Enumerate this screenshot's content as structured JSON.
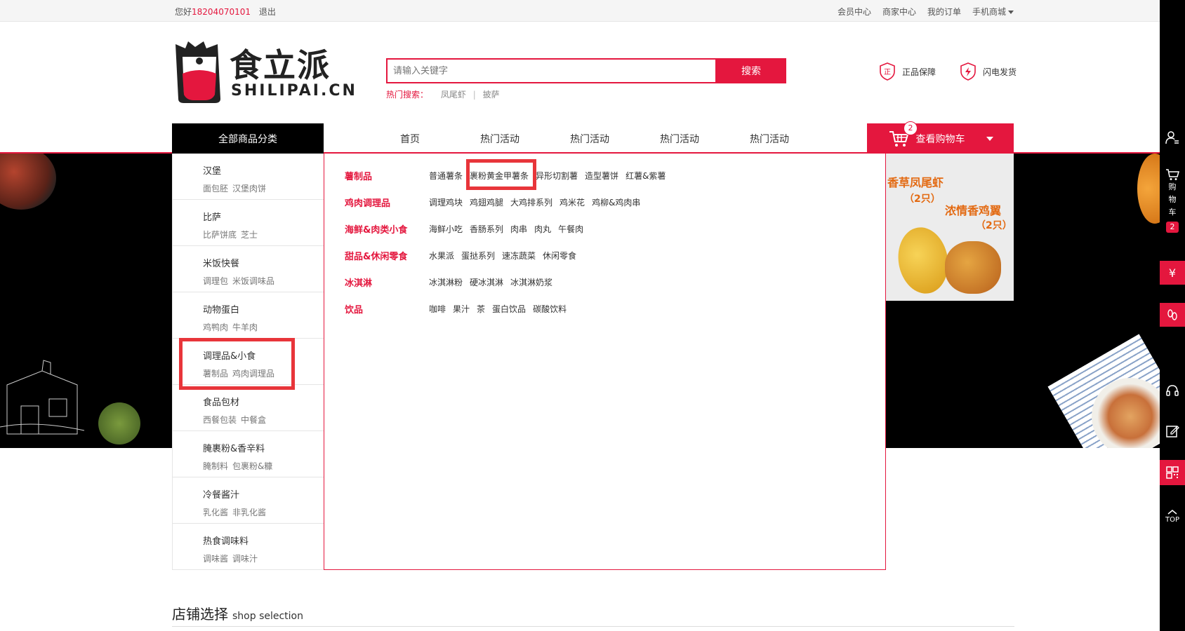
{
  "topbar": {
    "greeting": "您好",
    "phone": "18204070101",
    "logout": "退出",
    "links": [
      "会员中心",
      "商家中心",
      "我的订单",
      "手机商城"
    ]
  },
  "header": {
    "logo_text": "食立派",
    "logo_sub": "SHILIPAI.CN",
    "search_placeholder": "请输入关键字",
    "search_button": "搜索",
    "hot_label": "热门搜索：",
    "hot_keywords": [
      "凤尾虾",
      "披萨"
    ],
    "assure": [
      "正品保障",
      "闪电发货"
    ],
    "shield_char": "正"
  },
  "nav": {
    "all_categories": "全部商品分类",
    "links": [
      "首页",
      "热门活动",
      "热门活动",
      "热门活动",
      "热门活动"
    ],
    "cart_label": "查看购物车",
    "cart_count": "2"
  },
  "categories": [
    {
      "title": "汉堡",
      "subs": [
        "面包胚",
        "汉堡肉饼"
      ]
    },
    {
      "title": "比萨",
      "subs": [
        "比萨饼底",
        "芝士"
      ]
    },
    {
      "title": "米饭快餐",
      "subs": [
        "调理包",
        "米饭调味品"
      ]
    },
    {
      "title": "动物蛋白",
      "subs": [
        "鸡鸭肉",
        "牛羊肉"
      ]
    },
    {
      "title": "调理品&小食",
      "subs": [
        "薯制品",
        "鸡肉调理品"
      ]
    },
    {
      "title": "食品包材",
      "subs": [
        "西餐包装",
        "中餐盒"
      ]
    },
    {
      "title": "腌裹粉&香辛料",
      "subs": [
        "腌制料",
        "包裹粉&糠"
      ]
    },
    {
      "title": "冷餐酱汁",
      "subs": [
        "乳化酱",
        "非乳化酱"
      ]
    },
    {
      "title": "热食调味料",
      "subs": [
        "调味酱",
        "调味汁"
      ]
    }
  ],
  "submenu": [
    {
      "head": "薯制品",
      "items": [
        "普通薯条",
        "裹粉黄金甲薯条",
        "异形切割薯",
        "造型薯饼",
        "红薯&紫薯"
      ]
    },
    {
      "head": "鸡肉调理品",
      "items": [
        "调理鸡块",
        "鸡翅鸡腿",
        "大鸡排系列",
        "鸡米花",
        "鸡柳&鸡肉串"
      ]
    },
    {
      "head": "海鲜&肉类小食",
      "items": [
        "海鲜小吃",
        "香肠系列",
        "肉串",
        "肉丸",
        "午餐肉"
      ]
    },
    {
      "head": "甜品&休闲零食",
      "items": [
        "水果派",
        "蛋挞系列",
        "速冻蔬菜",
        "休闲零食"
      ]
    },
    {
      "head": "冰淇淋",
      "items": [
        "冰淇淋粉",
        "硬冰淇淋",
        "冰淇淋奶浆"
      ]
    },
    {
      "head": "饮品",
      "items": [
        "咖啡",
        "果汁",
        "茶",
        "蛋白饮品",
        "碳酸饮料"
      ]
    }
  ],
  "promo": {
    "line1": "香草凤尾虾",
    "line2": "（2只）",
    "line3": "浓情香鸡翼",
    "line4": "（2只）"
  },
  "shop": {
    "title": "店铺选择",
    "title_en": "shop selection"
  },
  "right_bar": {
    "cart_text": [
      "购",
      "物",
      "车"
    ],
    "cart_count": "2",
    "top_label": "TOP",
    "yen": "¥"
  },
  "colors": {
    "accent": "#e4173e",
    "highlight": "#e8353a"
  }
}
